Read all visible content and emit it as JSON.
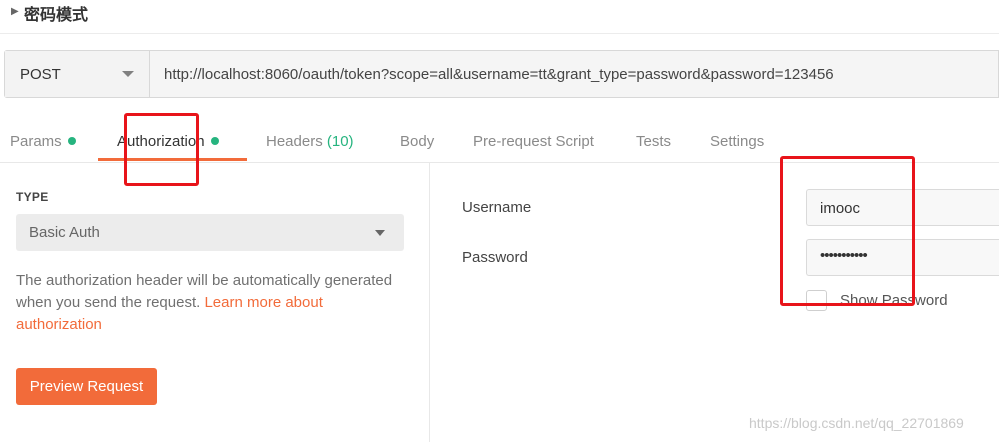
{
  "header": {
    "title": "密码模式"
  },
  "request": {
    "method": "POST",
    "url": "http://localhost:8060/oauth/token?scope=all&username=tt&grant_type=password&password=123456"
  },
  "tabs": [
    {
      "label": "Params"
    },
    {
      "label": "Authorization"
    },
    {
      "label": "Headers",
      "count": "(10)"
    },
    {
      "label": "Body"
    },
    {
      "label": "Pre-request Script"
    },
    {
      "label": "Tests"
    },
    {
      "label": "Settings"
    }
  ],
  "auth": {
    "type_label": "TYPE",
    "type_value": "Basic Auth",
    "description": "The authorization header will be automatically generated when you send the request. ",
    "learn_more": "Learn more about authorization",
    "preview_button": "Preview Request",
    "username_label": "Username",
    "username_value": "imooc",
    "password_label": "Password",
    "password_value": "•••••••••••",
    "show_password_label": "Show Password"
  },
  "watermark": "https://blog.csdn.net/qq_22701869",
  "colors": {
    "accent": "#f26b3a",
    "status_green": "#26b47f",
    "annotation_red": "#e8141a"
  }
}
